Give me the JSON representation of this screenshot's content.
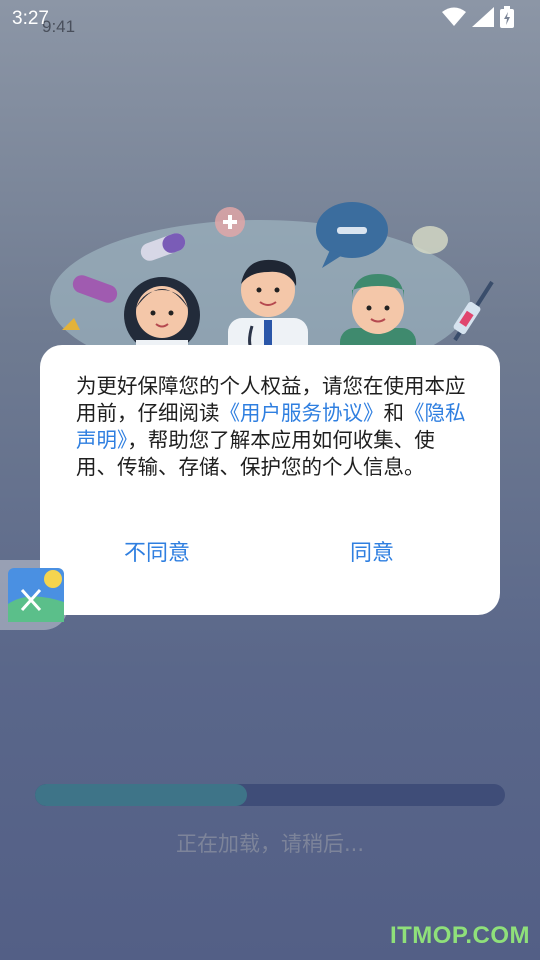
{
  "status_bar": {
    "time": "3:27",
    "ghost_time": "9:41",
    "icons": [
      "cell-signal-icon",
      "wifi-icon",
      "signal-icon",
      "battery-charging-icon"
    ]
  },
  "illustration": {
    "icons": [
      "doctor-female-icon",
      "doctor-male-icon",
      "surgeon-icon",
      "chat-bubble-icon",
      "syringe-icon",
      "pill-icon"
    ]
  },
  "dialog": {
    "text_before": "为更好保障您的个人权益，请您在使用本应用前，仔细阅读",
    "link_service": "《用户服务协议》",
    "text_and": "和",
    "link_privacy": "《隐私声明》",
    "text_after": "，帮助您了解本应用如何收集、使用、传输、存储、保护您的个人信息。",
    "disagree_label": "不同意",
    "agree_label": "同意",
    "link_color": "#2f7fe0"
  },
  "side_widget": {
    "icon": "gallery-app-icon"
  },
  "loading": {
    "progress": 0.45,
    "text": "正在加载，请稍后..."
  },
  "watermark": "ITMOP.COM"
}
